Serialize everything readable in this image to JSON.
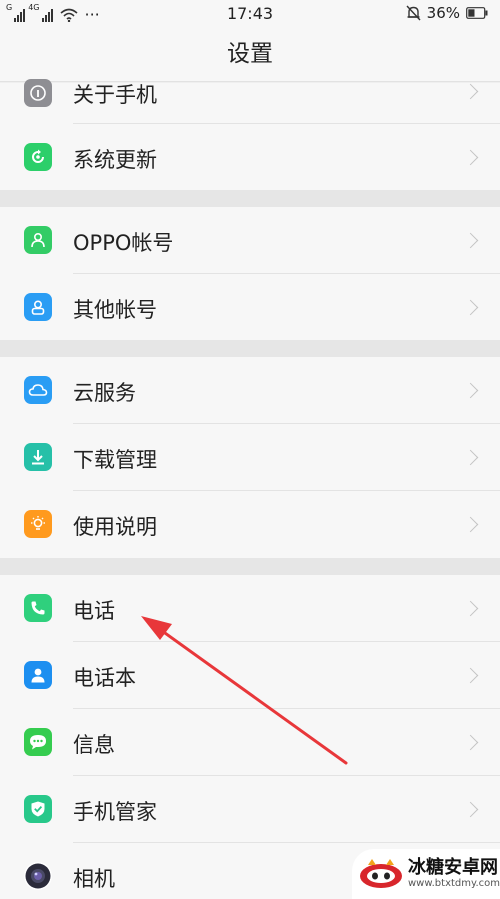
{
  "status_bar": {
    "left_signal_1": "G",
    "left_signal_2": "4G",
    "dots": "···",
    "time": "17:43",
    "battery": "36%"
  },
  "title": "设置",
  "groups": [
    {
      "items": [
        {
          "label": "关于手机",
          "icon": "info-icon",
          "color": "#8e8e93"
        },
        {
          "label": "系统更新",
          "icon": "update-icon",
          "color": "#2ccf6a"
        }
      ]
    },
    {
      "items": [
        {
          "label": "OPPO帐号",
          "icon": "person-icon",
          "color": "#33cc66"
        },
        {
          "label": "其他帐号",
          "icon": "account-icon",
          "color": "#2a9df4"
        }
      ]
    },
    {
      "items": [
        {
          "label": "云服务",
          "icon": "cloud-icon",
          "color": "#2a9df4"
        },
        {
          "label": "下载管理",
          "icon": "download-icon",
          "color": "#26c0a8"
        },
        {
          "label": "使用说明",
          "icon": "lightbulb-icon",
          "color": "#ff9a1e"
        }
      ]
    },
    {
      "items": [
        {
          "label": "电话",
          "icon": "phone-icon",
          "color": "#2fd07d"
        },
        {
          "label": "电话本",
          "icon": "contacts-icon",
          "color": "#1d8ff0"
        },
        {
          "label": "信息",
          "icon": "message-icon",
          "color": "#35cc4f"
        },
        {
          "label": "手机管家",
          "icon": "shield-icon",
          "color": "#28c88a"
        },
        {
          "label": "相机",
          "icon": "camera-icon",
          "color": "#3b3b4f"
        }
      ]
    }
  ],
  "annotation_color": "#e8373a",
  "watermark": {
    "title": "冰糖安卓网",
    "url": "www.btxtdmy.com"
  }
}
